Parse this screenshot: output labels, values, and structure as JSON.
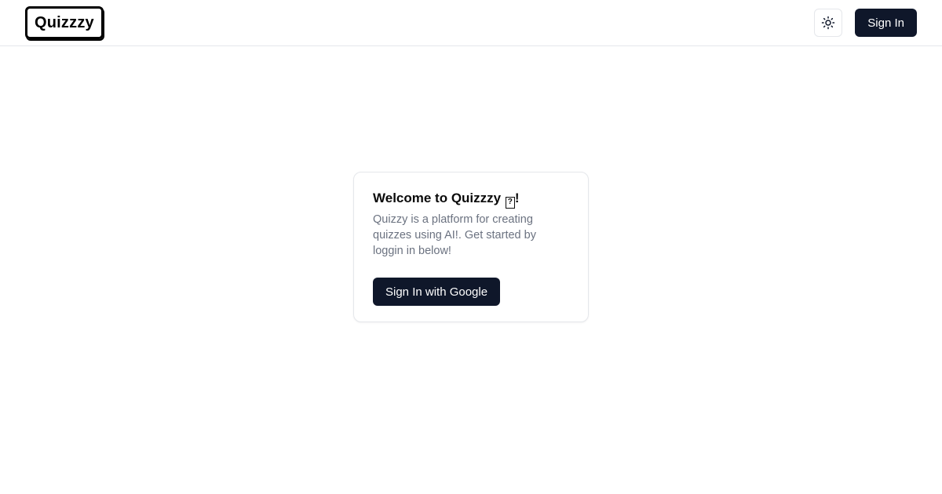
{
  "header": {
    "logo_text": "Quizzzy",
    "theme_toggle_icon": "sun-icon",
    "signin_label": "Sign In"
  },
  "card": {
    "title_prefix": "Welcome to Quizzzy ",
    "title_emoji": "?",
    "title_suffix": "!",
    "description": "Quizzy is a platform for creating quizzes using AI!. Get started by loggin in below!",
    "google_button_label": "Sign In with Google"
  },
  "colors": {
    "primary": "#0f172a",
    "muted_text": "#6b7280",
    "border": "#e5e7eb"
  }
}
